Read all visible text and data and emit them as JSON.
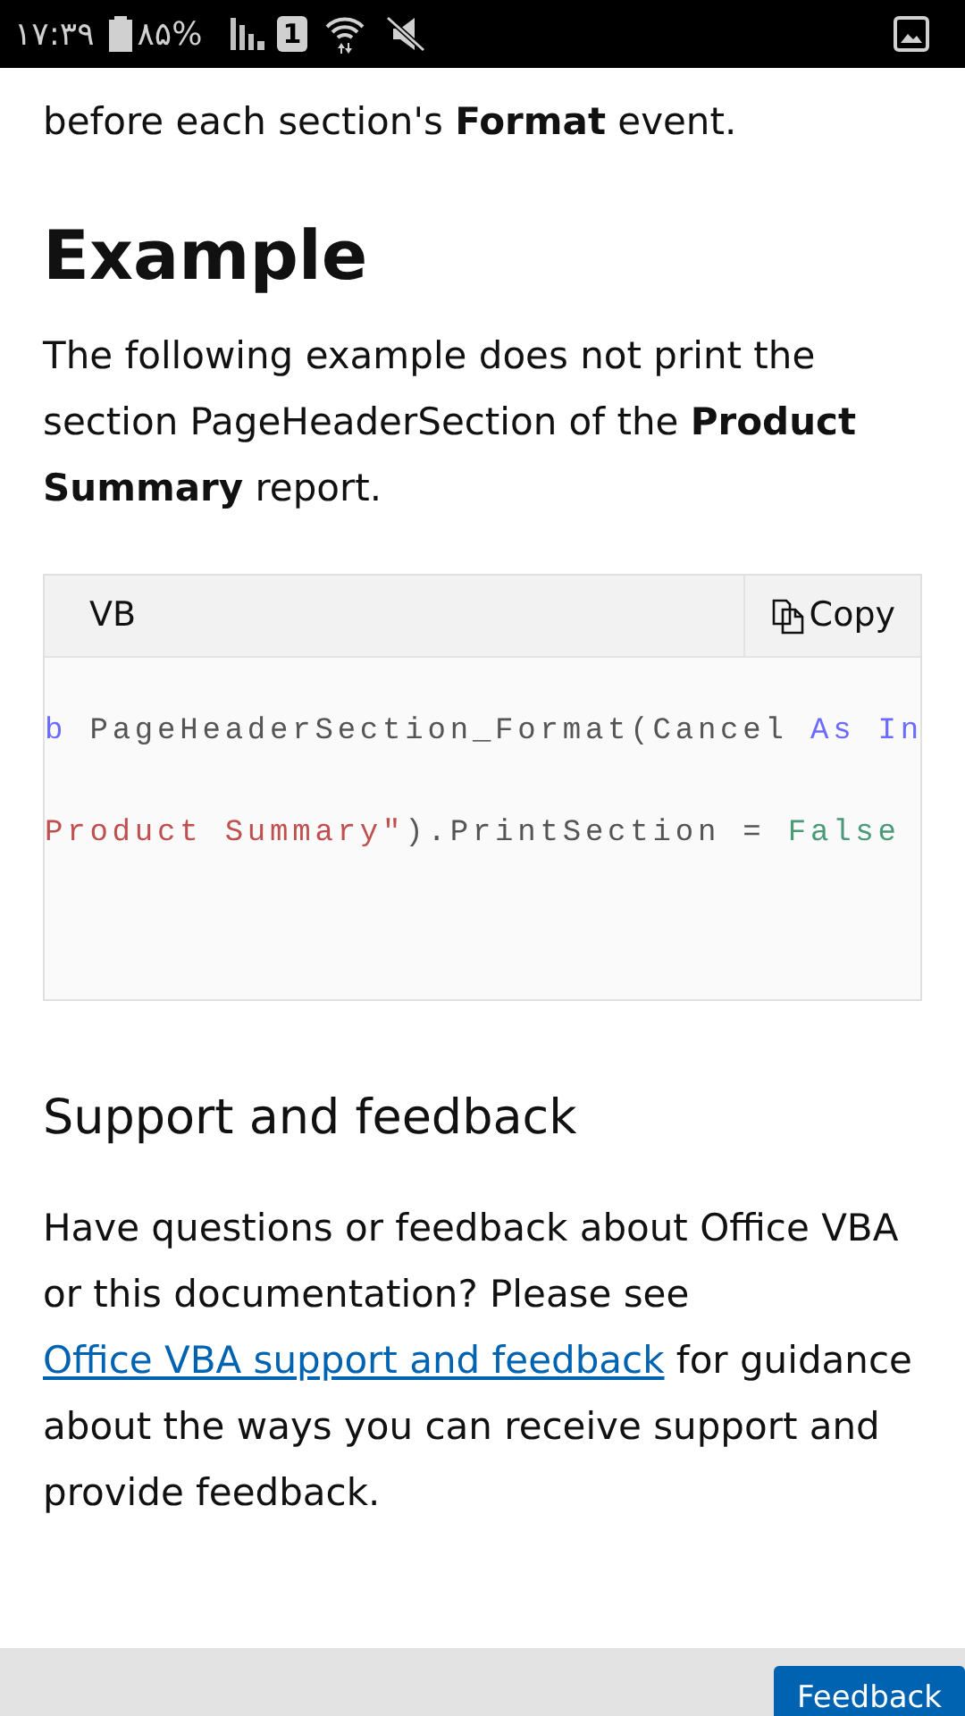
{
  "status_bar": {
    "time": "۱۷:۳۹",
    "battery": "۸۵%",
    "sim": "1"
  },
  "intro": "before each section's **Format** event.",
  "heading": "Example",
  "example_text": "The following example does not print the section PageHeaderSection of the **Product Summary** report.",
  "code_block": {
    "language": "VB",
    "copy_label": "Copy",
    "lines": [
      [
        {
          "kind": "keyword",
          "text": "b"
        },
        {
          "kind": "plain",
          "text": " PageHeaderSection_Format(Cancel "
        },
        {
          "kind": "keyword",
          "text": "As In"
        }
      ],
      [
        {
          "kind": "string",
          "text": "Product Summary\""
        },
        {
          "kind": "plain",
          "text": ").PrintSection = "
        },
        {
          "kind": "literal",
          "text": "False"
        }
      ]
    ]
  },
  "support": {
    "heading": "Support and feedback",
    "text_before": "Have questions or feedback about Office VBA or this documentation? Please see ",
    "link": "Office VBA support and feedback",
    "text_after": " for guidance about the ways you can receive support and provide feedback."
  },
  "feedback_button": "Feedback"
}
